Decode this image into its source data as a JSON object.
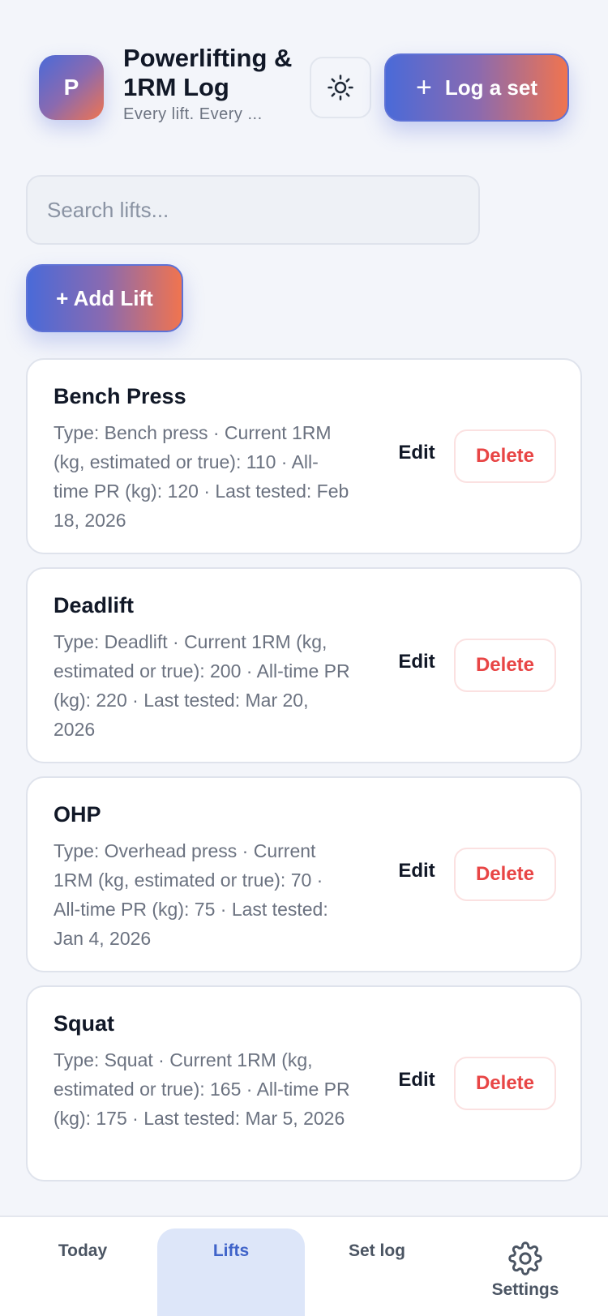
{
  "header": {
    "logo_letter": "P",
    "title": "Powerlifting & 1RM Log",
    "subtitle": "Every lift. Every ...",
    "theme_icon": "sun-icon",
    "log_button_label": "Log a set"
  },
  "search": {
    "placeholder": "Search lifts..."
  },
  "add_lift_label": "+ Add Lift",
  "lifts": [
    {
      "name": "Bench Press",
      "meta": "Type: Bench press · Current 1RM (kg, estimated or true): 110 · All-time PR (kg): 120 · Last tested: Feb 18, 2026",
      "edit_label": "Edit",
      "delete_label": "Delete"
    },
    {
      "name": "Deadlift",
      "meta": "Type: Deadlift · Current 1RM (kg, estimated or true): 200 · All-time PR (kg): 220 · Last tested: Mar 20, 2026",
      "edit_label": "Edit",
      "delete_label": "Delete"
    },
    {
      "name": "OHP",
      "meta": "Type: Overhead press · Current 1RM (kg, estimated or true): 70 · All-time PR (kg): 75 · Last tested: Jan 4, 2026",
      "edit_label": "Edit",
      "delete_label": "Delete"
    },
    {
      "name": "Squat",
      "meta": "Type: Squat · Current 1RM (kg, estimated or true): 165 · All-time PR (kg): 175 · Last tested: Mar 5, 2026",
      "edit_label": "Edit",
      "delete_label": "Delete"
    }
  ],
  "nav": {
    "today": "Today",
    "lifts": "Lifts",
    "set_log": "Set log",
    "settings": "Settings",
    "active": "Lifts"
  },
  "colors": {
    "accent_start": "#4a6ad8",
    "accent_end": "#f0744f",
    "danger": "#e84545",
    "nav_active_bg": "#dde6f9",
    "nav_active_text": "#3f63c9"
  }
}
